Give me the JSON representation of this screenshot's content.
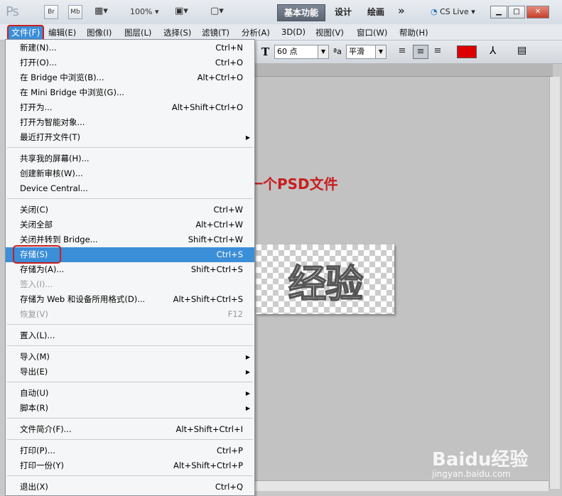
{
  "titlebar": {
    "logo": "Ps",
    "bridge_btn": "Br",
    "minibridge_btn": "Mb",
    "zoom": "100%",
    "workspaces": [
      "基本功能",
      "设计",
      "绘画"
    ],
    "more": "»",
    "cslive": "CS Live"
  },
  "menubar": [
    "文件(F)",
    "编辑(E)",
    "图像(I)",
    "图层(L)",
    "选择(S)",
    "滤镜(T)",
    "分析(A)",
    "3D(D)",
    "视图(V)",
    "窗口(W)",
    "帮助(H)"
  ],
  "options": {
    "font_size": "60 点",
    "antialias": "平滑",
    "text_color": "#dd0000"
  },
  "annotation": "把这个图形保存为一个PSD文件",
  "canvas_text": "经验",
  "file_menu": {
    "items": [
      {
        "label": "新建(N)...",
        "shortcut": "Ctrl+N"
      },
      {
        "label": "打开(O)...",
        "shortcut": "Ctrl+O"
      },
      {
        "label": "在 Bridge 中浏览(B)...",
        "shortcut": "Alt+Ctrl+O"
      },
      {
        "label": "在 Mini Bridge 中浏览(G)...",
        "shortcut": ""
      },
      {
        "label": "打开为...",
        "shortcut": "Alt+Shift+Ctrl+O"
      },
      {
        "label": "打开为智能对象...",
        "shortcut": ""
      },
      {
        "label": "最近打开文件(T)",
        "shortcut": ""
      },
      {
        "label": "共享我的屏幕(H)...",
        "shortcut": ""
      },
      {
        "label": "创建新审核(W)...",
        "shortcut": ""
      },
      {
        "label": "Device Central...",
        "shortcut": ""
      },
      {
        "label": "关闭(C)",
        "shortcut": "Ctrl+W"
      },
      {
        "label": "关闭全部",
        "shortcut": "Alt+Ctrl+W"
      },
      {
        "label": "关闭并转到 Bridge...",
        "shortcut": "Shift+Ctrl+W"
      },
      {
        "label": "存储(S)",
        "shortcut": "Ctrl+S"
      },
      {
        "label": "存储为(A)...",
        "shortcut": "Shift+Ctrl+S"
      },
      {
        "label": "签入(I)...",
        "shortcut": ""
      },
      {
        "label": "存储为 Web 和设备所用格式(D)...",
        "shortcut": "Alt+Shift+Ctrl+S"
      },
      {
        "label": "恢复(V)",
        "shortcut": "F12"
      },
      {
        "label": "置入(L)...",
        "shortcut": ""
      },
      {
        "label": "导入(M)",
        "shortcut": ""
      },
      {
        "label": "导出(E)",
        "shortcut": ""
      },
      {
        "label": "自动(U)",
        "shortcut": ""
      },
      {
        "label": "脚本(R)",
        "shortcut": ""
      },
      {
        "label": "文件简介(F)...",
        "shortcut": "Alt+Shift+Ctrl+I"
      },
      {
        "label": "打印(P)...",
        "shortcut": "Ctrl+P"
      },
      {
        "label": "打印一份(Y)",
        "shortcut": "Alt+Shift+Ctrl+P"
      },
      {
        "label": "退出(X)",
        "shortcut": "Ctrl+Q"
      }
    ]
  },
  "watermark": {
    "logo": "Baidu经验",
    "url": "jingyan.baidu.com"
  }
}
